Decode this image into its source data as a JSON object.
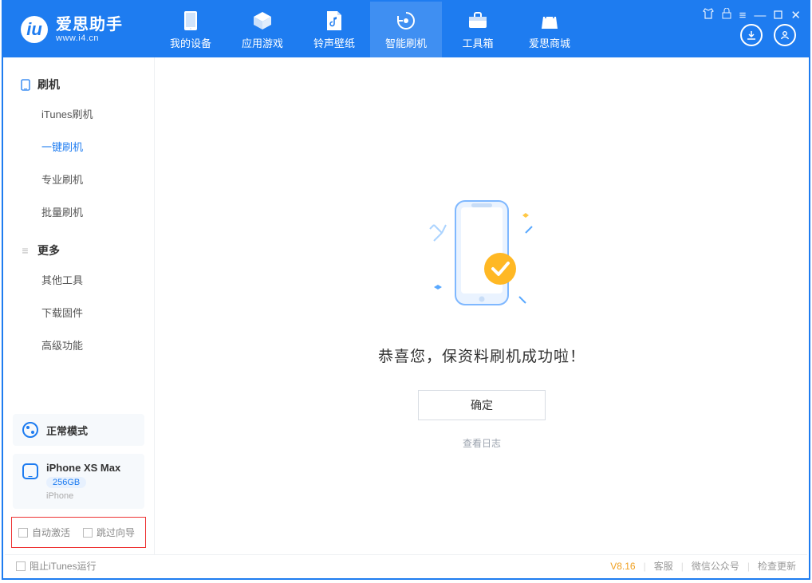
{
  "app": {
    "name": "爱思助手",
    "url": "www.i4.cn"
  },
  "nav": {
    "items": [
      {
        "label": "我的设备"
      },
      {
        "label": "应用游戏"
      },
      {
        "label": "铃声壁纸"
      },
      {
        "label": "智能刷机"
      },
      {
        "label": "工具箱"
      },
      {
        "label": "爱思商城"
      }
    ]
  },
  "sidebar": {
    "group1": {
      "title": "刷机",
      "items": [
        {
          "label": "iTunes刷机"
        },
        {
          "label": "一键刷机"
        },
        {
          "label": "专业刷机"
        },
        {
          "label": "批量刷机"
        }
      ]
    },
    "group2": {
      "title": "更多",
      "items": [
        {
          "label": "其他工具"
        },
        {
          "label": "下载固件"
        },
        {
          "label": "高级功能"
        }
      ]
    },
    "mode": {
      "label": "正常模式"
    },
    "device": {
      "name": "iPhone XS Max",
      "capacity": "256GB",
      "type": "iPhone"
    },
    "options": {
      "auto_activate": "自动激活",
      "skip_guide": "跳过向导"
    }
  },
  "main": {
    "success_title": "恭喜您，保资料刷机成功啦！",
    "ok_button": "确定",
    "view_log": "查看日志"
  },
  "footer": {
    "block_itunes": "阻止iTunes运行",
    "version": "V8.16",
    "support": "客服",
    "wechat": "微信公众号",
    "check_update": "检查更新"
  }
}
